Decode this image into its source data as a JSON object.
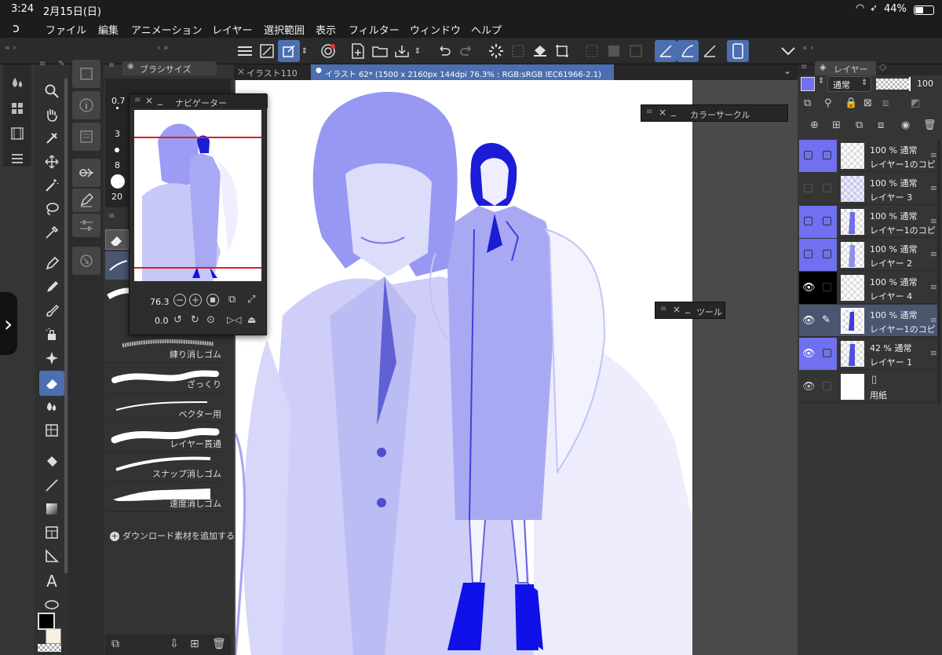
{
  "status": {
    "time": "3:24",
    "date": "2月15日(日)",
    "battery": "44%"
  },
  "menu": [
    "ファイル",
    "編集",
    "アニメーション",
    "レイヤー",
    "選択範囲",
    "表示",
    "フィルター",
    "ウィンドウ",
    "ヘルプ"
  ],
  "brush_size_panel": {
    "title": "ブラシサイズ",
    "sizes": [
      "0.7",
      "3",
      "8",
      "20"
    ]
  },
  "navigator": {
    "title": "ナビゲーター",
    "zoom": "76.3",
    "rotation": "0.0"
  },
  "tabs": {
    "inactive": "イラスト110",
    "active": "イラスト 62* (1500 x 2160px 144dpi 76.3% : RGB:sRGB IEC61966-2.1)"
  },
  "color_circle": {
    "title": "カラーサークル"
  },
  "tool_panel": {
    "title": "ツール"
  },
  "erasers": [
    {
      "name": "練り消しゴム"
    },
    {
      "name": "ざっくり"
    },
    {
      "name": "ベクター用"
    },
    {
      "name": "レイヤー貫通"
    },
    {
      "name": "スナップ消しゴム"
    },
    {
      "name": "速度消しゴム"
    }
  ],
  "add_material": "ダウンロード素材を追加する",
  "layers_panel": {
    "title": "レイヤー",
    "blend": "通常",
    "opacity": "100",
    "layers": [
      {
        "l1": "100 % 通常",
        "l2": "レイヤー1のコピ"
      },
      {
        "l1": "100 % 通常",
        "l2": "レイヤー 3"
      },
      {
        "l1": "100 % 通常",
        "l2": "レイヤー1のコピ"
      },
      {
        "l1": "100 % 通常",
        "l2": "レイヤー 2"
      },
      {
        "l1": "100 % 通常",
        "l2": "レイヤー 4"
      },
      {
        "l1": "100 % 通常",
        "l2": "レイヤー1のコピ"
      },
      {
        "l1": "42 % 通常",
        "l2": "レイヤー 1"
      },
      {
        "l1": "",
        "l2": "用紙"
      }
    ]
  },
  "colors": {
    "accent": "#4b6fb0",
    "layer_color": "#7070f0",
    "ink": "#1a1aee",
    "light_ink": "#8a8af0"
  }
}
